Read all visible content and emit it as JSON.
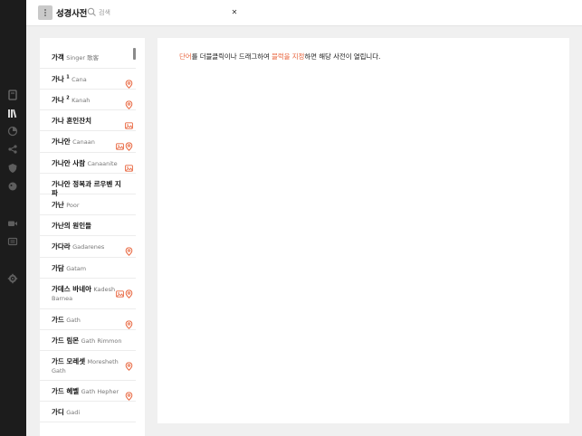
{
  "topbar": {
    "title": "성경사전",
    "search_placeholder": "검색",
    "clear_label": "✕"
  },
  "rail": {
    "icons": [
      "book-icon",
      "library-icon",
      "pie-chart-icon",
      "share-icon",
      "shield-icon",
      "bubble-icon",
      "video-icon",
      "image-icon",
      "gear-icon"
    ]
  },
  "list": {
    "items": [
      {
        "main": "가객",
        "sup": "",
        "sub": "Singer 歌客",
        "sub2": "",
        "icons": []
      },
      {
        "main": "가나",
        "sup": "1",
        "sub": "Cana",
        "sub2": "",
        "icons": [
          "pin"
        ]
      },
      {
        "main": "가나",
        "sup": "2",
        "sub": "Kanah",
        "sub2": "",
        "icons": [
          "pin"
        ]
      },
      {
        "main": "가나 혼인잔치",
        "sup": "",
        "sub": "",
        "sub2": "",
        "icons": [
          "image"
        ]
      },
      {
        "main": "가나안",
        "sup": "",
        "sub": "Canaan",
        "sub2": "",
        "icons": [
          "image",
          "pin"
        ]
      },
      {
        "main": "가나안 사람",
        "sup": "",
        "sub": "Canaanite",
        "sub2": "",
        "icons": [
          "image"
        ]
      },
      {
        "main": "가나안 정복과 르우벤 지파",
        "sup": "",
        "sub": "",
        "sub2": "",
        "icons": []
      },
      {
        "main": "가난",
        "sup": "",
        "sub": "Poor",
        "sub2": "",
        "icons": []
      },
      {
        "main": "가난의 원인들",
        "sup": "",
        "sub": "",
        "sub2": "",
        "icons": []
      },
      {
        "main": "가다라",
        "sup": "",
        "sub": "Gadarenes",
        "sub2": "",
        "icons": [
          "pin"
        ]
      },
      {
        "main": "가담",
        "sup": "",
        "sub": "Gatam",
        "sub2": "",
        "icons": []
      },
      {
        "main": "가데스 바네아",
        "sup": "",
        "sub": "Kadesh",
        "sub2": "Barnea",
        "icons": [
          "image",
          "pin"
        ]
      },
      {
        "main": "가드",
        "sup": "",
        "sub": "Gath",
        "sub2": "",
        "icons": [
          "pin"
        ]
      },
      {
        "main": "가드 림몬",
        "sup": "",
        "sub": "Gath Rimmon",
        "sub2": "",
        "icons": []
      },
      {
        "main": "가드 모레셋",
        "sup": "",
        "sub": "Moresheth",
        "sub2": "Gath",
        "icons": [
          "pin"
        ]
      },
      {
        "main": "가드 헤벨",
        "sup": "",
        "sub": "Gath Hepher",
        "sub2": "",
        "icons": [
          "pin"
        ]
      },
      {
        "main": "가디",
        "sup": "",
        "sub": "Gadi",
        "sub2": "",
        "icons": []
      }
    ]
  },
  "content": {
    "hint_part1": "단어",
    "hint_part2": "를 더블클릭이나 드래그하여 ",
    "hint_part3": "블럭을 지정",
    "hint_part4": "하면 해당 사전이 열립니다."
  },
  "colors": {
    "accent": "#e8643c",
    "rail": "#1c1c1c",
    "background": "#f0f0f0"
  }
}
